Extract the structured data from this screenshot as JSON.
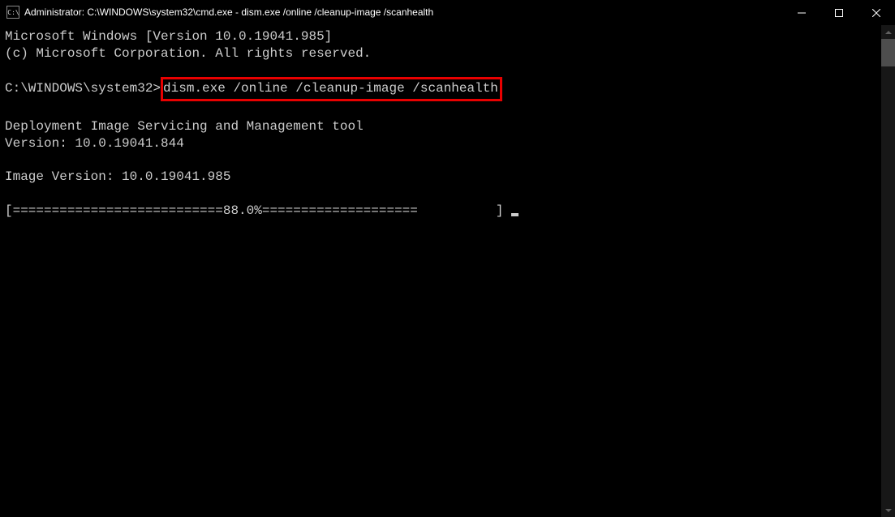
{
  "titlebar": {
    "title": "Administrator: C:\\WINDOWS\\system32\\cmd.exe - dism.exe  /online /cleanup-image /scanhealth"
  },
  "terminal": {
    "line1": "Microsoft Windows [Version 10.0.19041.985]",
    "line2": "(c) Microsoft Corporation. All rights reserved.",
    "prompt": "C:\\WINDOWS\\system32>",
    "command": "dism.exe /online /cleanup-image /scanhealth",
    "tool_line1": "Deployment Image Servicing and Management tool",
    "tool_line2": "Version: 10.0.19041.844",
    "image_version": "Image Version: 10.0.19041.985",
    "progress": "[===========================88.0%====================          ] "
  }
}
